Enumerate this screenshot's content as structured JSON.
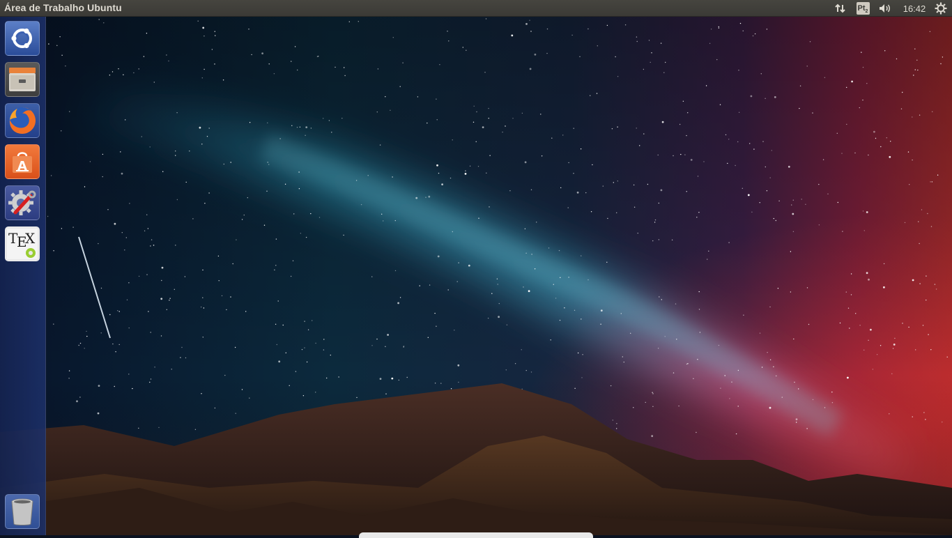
{
  "top_panel": {
    "title": "Área de Trabalho Ubuntu",
    "keyboard_layout": "Pt",
    "keyboard_sub": "2",
    "clock": "16:42",
    "icons": [
      "network-transfer-icon",
      "keyboard-layout-icon",
      "volume-icon",
      "system-gear-icon"
    ]
  },
  "launcher": {
    "items": [
      {
        "name": "ubuntu-dash",
        "icon": "ubuntu-logo-icon"
      },
      {
        "name": "files",
        "icon": "file-cabinet-icon"
      },
      {
        "name": "firefox",
        "icon": "firefox-icon"
      },
      {
        "name": "ubuntu-software-center",
        "icon": "shopping-bag-icon"
      },
      {
        "name": "system-settings",
        "icon": "wrench-gear-icon"
      },
      {
        "name": "texmaker",
        "icon": "tex-icon",
        "label": "TEX"
      },
      {
        "name": "trash",
        "icon": "trash-icon"
      }
    ]
  },
  "colors": {
    "panel_bg": "#3c3b37",
    "launcher_bg": "#1c2f66",
    "software_orange": "#e8612c"
  }
}
